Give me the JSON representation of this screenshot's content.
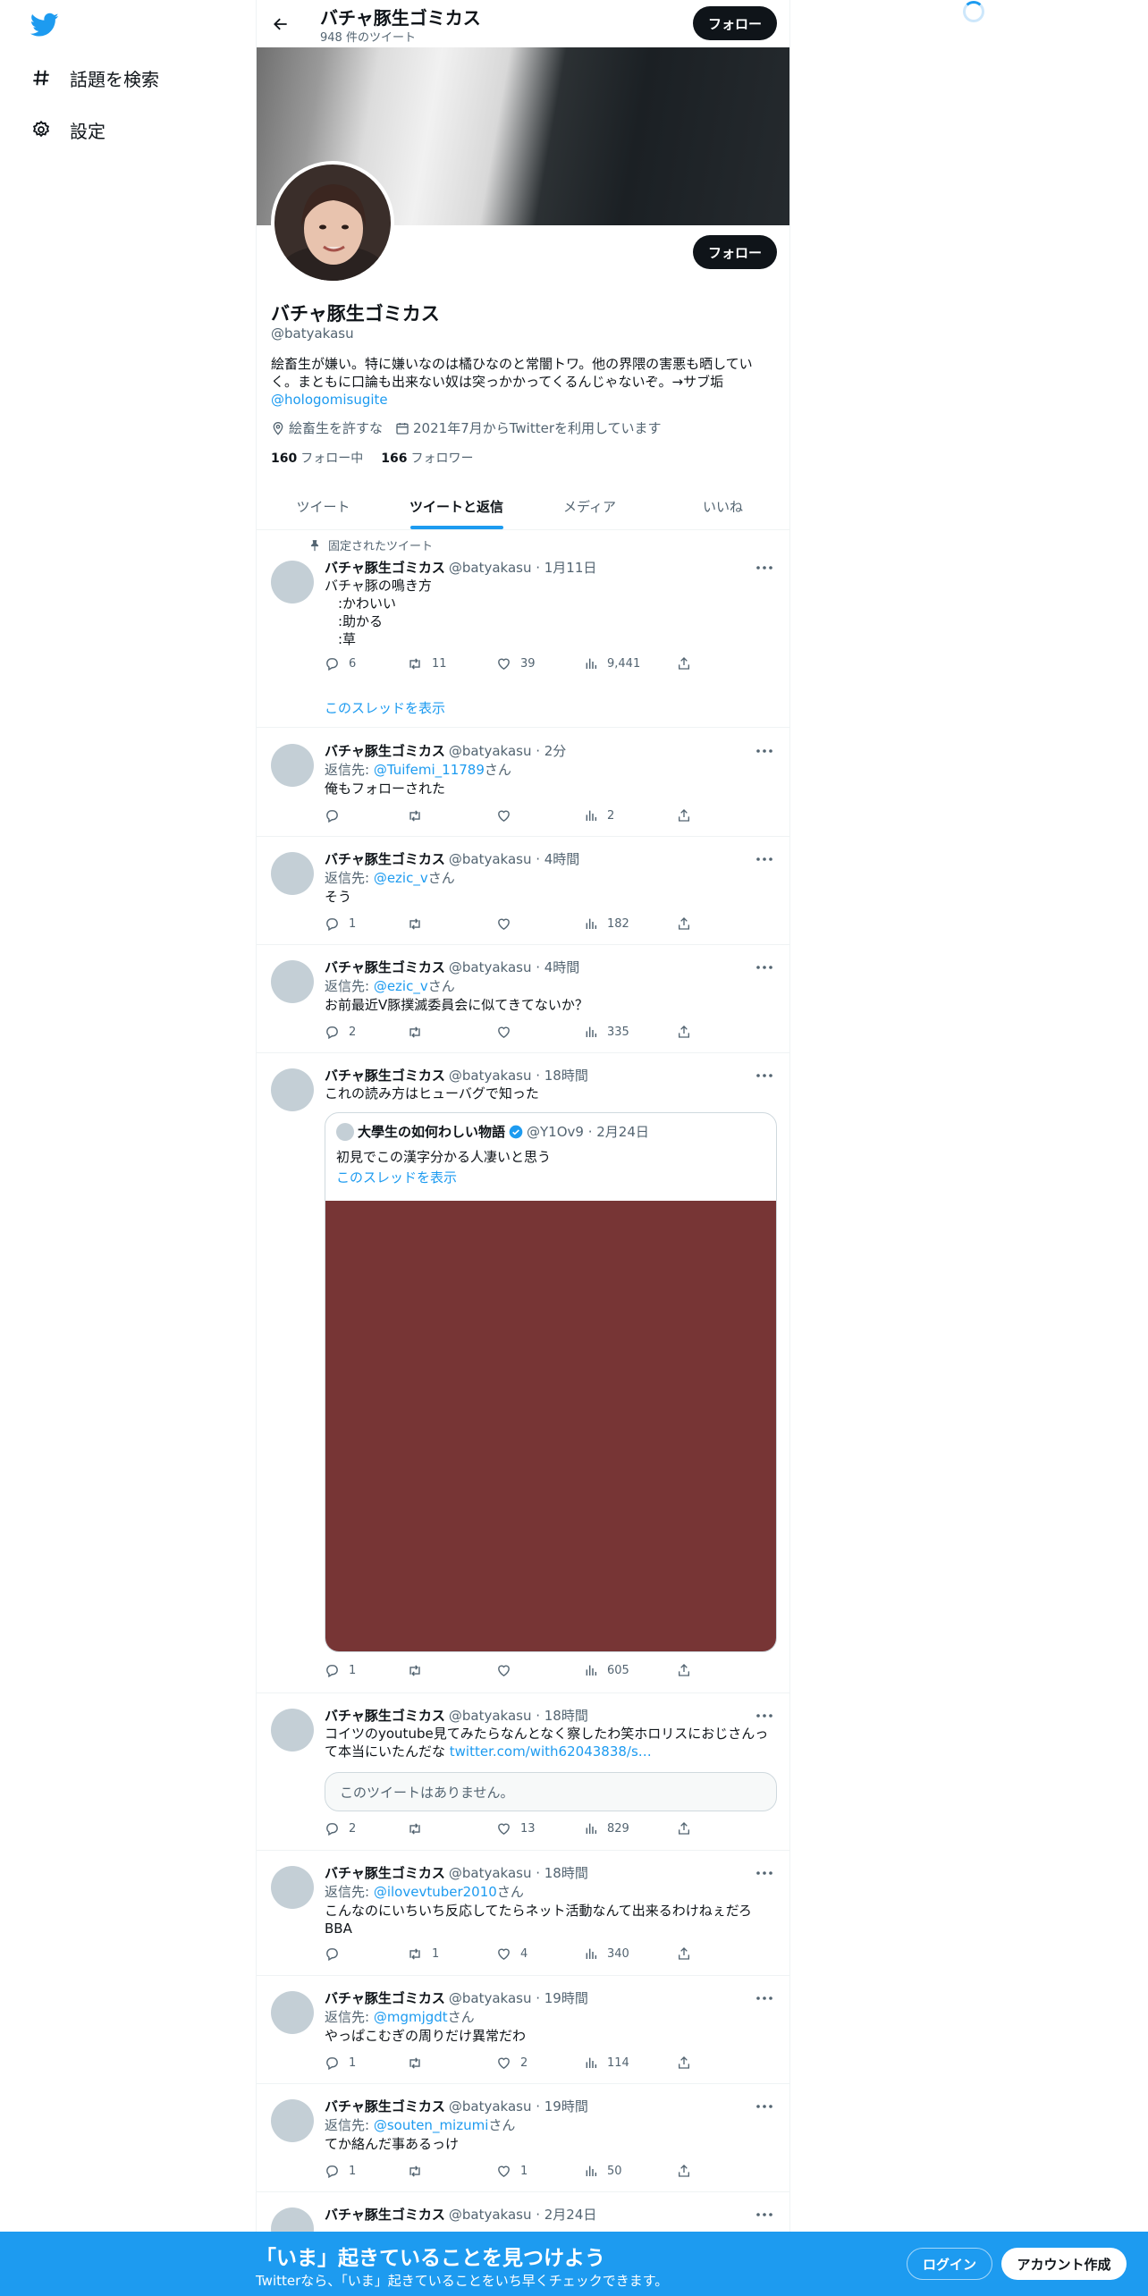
{
  "nav": {
    "items": [
      {
        "icon": "hashtag-icon",
        "label": "話題を検索"
      },
      {
        "icon": "gear-icon",
        "label": "設定"
      }
    ]
  },
  "header": {
    "name": "バチャ豚生ゴミカス",
    "tweet_count": "948 件のツイート",
    "follow_label": "フォロー"
  },
  "profile": {
    "name": "バチャ豚生ゴミカス",
    "handle": "@batyakasu",
    "bio": "絵畜生が嫌い。特に嫌いなのは橘ひなのと常闇トワ。他の界隈の害悪も晒していく。まともに口論も出来ない奴は突っかかってくるんじゃないぞ。→サブ垢",
    "bio_link": "@hologomisugite",
    "location": "絵畜生を許すな",
    "joined": "2021年7月からTwitterを利用しています",
    "following_count": "160",
    "following_label": "フォロー中",
    "followers_count": "166",
    "followers_label": "フォロワー",
    "follow_label": "フォロー"
  },
  "tabs": [
    "ツイート",
    "ツイートと返信",
    "メディア",
    "いいね"
  ],
  "pinned_label": "固定されたツイート",
  "show_thread": "このスレッドを表示",
  "tweets": [
    {
      "name": "バチャ豚生ゴミカス",
      "meta": "@batyakasu · 1月11日",
      "text": "バチャ豚の鳴き方\n　:かわいい\n　:助かる\n　:草",
      "reply": "6",
      "retweet": "11",
      "like": "39",
      "views": "9,441"
    },
    {
      "name": "バチャ豚生ゴミカス",
      "meta": "@batyakasu · 2分",
      "reply_prefix": "返信先: ",
      "reply_to": "@Tuifemi_11789",
      "reply_suffix": "さん",
      "text": "俺もフォローされた",
      "reply": "",
      "retweet": "",
      "like": "",
      "views": "2"
    },
    {
      "name": "バチャ豚生ゴミカス",
      "meta": "@batyakasu · 4時間",
      "reply_prefix": "返信先: ",
      "reply_to": "@ezic_v",
      "reply_suffix": "さん",
      "text": "そう",
      "reply": "1",
      "retweet": "",
      "like": "",
      "views": "182"
    },
    {
      "name": "バチャ豚生ゴミカス",
      "meta": "@batyakasu · 4時間",
      "reply_prefix": "返信先: ",
      "reply_to": "@ezic_v",
      "reply_suffix": "さん",
      "text": "お前最近V豚撲滅委員会に似てきてないか？",
      "reply": "2",
      "retweet": "",
      "like": "",
      "views": "335"
    },
    {
      "name": "バチャ豚生ゴミカス",
      "meta": "@batyakasu · 18時間",
      "text": "これの読み方はヒューバグで知った",
      "reply": "1",
      "retweet": "",
      "like": "",
      "views": "605",
      "quote": {
        "name": "大學生の如何わしい物語",
        "meta": "@Y1Ov9 · 2月24日",
        "text": "初見でこの漢字分かる人凄いと思う",
        "thread": "このスレッドを表示"
      }
    },
    {
      "name": "バチャ豚生ゴミカス",
      "meta": "@batyakasu · 18時間",
      "text": "コイツのyoutube見てみたらなんとなく察したわ笑ホロリスにおじさんって本当にいたんだな ",
      "link": "twitter.com/with62043838/s…",
      "unavailable": "このツイートはありません。",
      "reply": "2",
      "retweet": "",
      "like": "13",
      "views": "829"
    },
    {
      "name": "バチャ豚生ゴミカス",
      "meta": "@batyakasu · 18時間",
      "reply_prefix": "返信先: ",
      "reply_to": "@ilovevtuber2010",
      "reply_suffix": "さん",
      "text": "こんなのにいちいち反応してたらネット活動なんて出来るわけねぇだろBBA",
      "reply": "",
      "retweet": "1",
      "like": "4",
      "views": "340"
    },
    {
      "name": "バチャ豚生ゴミカス",
      "meta": "@batyakasu · 19時間",
      "reply_prefix": "返信先: ",
      "reply_to": "@mgmjgdt",
      "reply_suffix": "さん",
      "text": "やっぱこむぎの周りだけ異常だわ",
      "reply": "1",
      "retweet": "",
      "like": "2",
      "views": "114"
    },
    {
      "name": "バチャ豚生ゴミカス",
      "meta": "@batyakasu · 19時間",
      "reply_prefix": "返信先: ",
      "reply_to": "@souten_mizumi",
      "reply_suffix": "さん",
      "text": "てか絡んだ事あるっけ",
      "reply": "1",
      "retweet": "",
      "like": "1",
      "views": "50"
    },
    {
      "name": "バチャ豚生ゴミカス",
      "meta": "@batyakasu · 2月24日"
    }
  ],
  "bottom_bar": {
    "title": "「いま」起きていることを見つけよう",
    "subtitle": "Twitterなら、「いま」起きていることをいち早くチェックできます。",
    "login": "ログイン",
    "signup": "アカウント作成"
  },
  "colors": {
    "accent": "#1d9bf0",
    "text": "#0f1419",
    "muted": "#536471",
    "quote_image": "#773535"
  }
}
